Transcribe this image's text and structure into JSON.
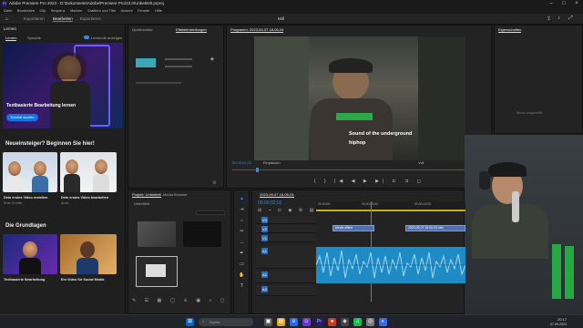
{
  "window": {
    "title": "Adobe Premiere Pro 2023 - D:\\Dokumente\\Adobe\\Premiere Pro\\23.0\\Unbetitelt.prproj"
  },
  "menu": [
    "Datei",
    "Bearbeiten",
    "Clip",
    "Sequenz",
    "Marken",
    "Grafiken und Titel",
    "Ansicht",
    "Fenster",
    "Hilfe"
  ],
  "workspaces": {
    "items": [
      "Importieren",
      "Bearbeiten",
      "Exportieren"
    ],
    "active": 1,
    "center_label": "Mill"
  },
  "learn": {
    "panel_title": "Lernen",
    "tabs": [
      "Lernen",
      "Sprache"
    ],
    "toggle_label": "Lernende anzeigen",
    "hero": {
      "title": "Textbasierte Bearbeitung lernen",
      "button": "Tutorial starten"
    },
    "section1": "Neueinsteiger? Beginnen Sie hier!",
    "cards1": [
      {
        "title": "Dein erstes Video erstellen",
        "sub": "Erste Schritte"
      },
      {
        "title": "Dein erstes Video bearbeiten",
        "sub": "Audio"
      }
    ],
    "section2": "Die Grundlagen",
    "cards2": [
      {
        "title": "Textbasierte Bearbeitung",
        "sub": ""
      },
      {
        "title": "Ein Video für Social Media",
        "sub": ""
      }
    ]
  },
  "source": {
    "tabs": [
      "Quellmonitor",
      "Effekteinstellungen"
    ]
  },
  "program": {
    "title": "Programm: 2023-09-07 18-06-04",
    "timecode_left": "00;00;02;02",
    "zoom": "Einpassen",
    "quality": "Voll",
    "caption_lines": [
      "Sound of the underground",
      "hiphop"
    ]
  },
  "properties": {
    "title": "Eigenschaften",
    "placeholder": "Nichts ausgewählt"
  },
  "project": {
    "tabs": [
      "Projekt: Unbetitelt",
      "Media Browser"
    ],
    "folder": "Unbetitelt",
    "search_placeholder": ""
  },
  "timeline": {
    "tab": "2023-09-07 18-06-04",
    "timecode": "00;00;02;02",
    "ruler": [
      "00;00;00",
      "00;00;05;00",
      "00;00;10;00",
      "00;00;15;00"
    ],
    "tracks": [
      "V3",
      "V2",
      "V1",
      "A1",
      "A2",
      "A3"
    ],
    "clips": [
      "Media offline",
      "2023-09-07 18-06-04.mkv"
    ]
  },
  "taskbar": {
    "search_placeholder": "Suche",
    "time": "20:17",
    "date": "07.09.2023"
  },
  "colors": {
    "accent": "#2d8ceb",
    "clip": "#4f6fb0",
    "audio": "#1f8bc5",
    "vu": "#28a745"
  }
}
